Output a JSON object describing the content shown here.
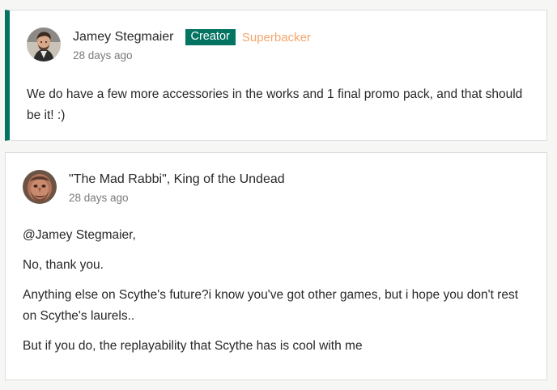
{
  "comments": [
    {
      "author": "Jamey Stegmaier",
      "badges": {
        "creator": "Creator",
        "superbacker": "Superbacker"
      },
      "time": "28 days ago",
      "paragraphs": [
        "We do have a few more accessories in the works and 1 final promo pack, and that should be it! :)"
      ],
      "accent_color": "#037362"
    },
    {
      "author": "\"The Mad Rabbi\", King of the Undead",
      "time": "28 days ago",
      "paragraphs": [
        "@Jamey Stegmaier,",
        "No, thank you.",
        "Anything else on Scythe's future?i know you've got other games, but i hope you don't rest on Scythe's laurels..",
        "But if you do, the replayability that Scythe has is cool with me"
      ]
    }
  ],
  "colors": {
    "creator_badge_bg": "#037362",
    "superbacker_text": "#f3a56d",
    "meta_text": "#7a7a7a"
  }
}
